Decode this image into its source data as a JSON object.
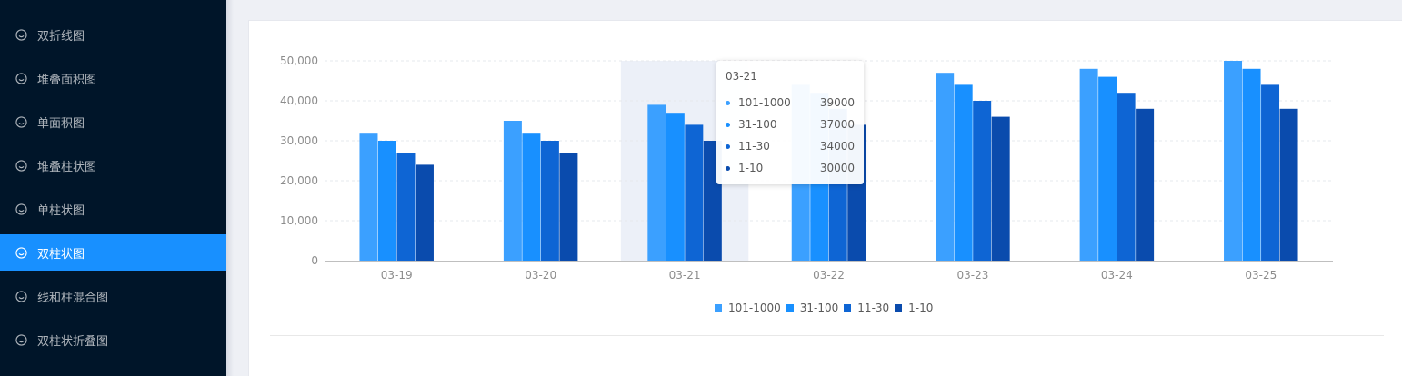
{
  "sidebar": {
    "items": [
      {
        "label": "双折线图",
        "active": false
      },
      {
        "label": "堆叠面积图",
        "active": false
      },
      {
        "label": "单面积图",
        "active": false
      },
      {
        "label": "堆叠柱状图",
        "active": false
      },
      {
        "label": "单柱状图",
        "active": false
      },
      {
        "label": "双柱状图",
        "active": true
      },
      {
        "label": "线和柱混合图",
        "active": false
      },
      {
        "label": "双柱状折叠图",
        "active": false
      }
    ]
  },
  "colors": {
    "sidebar_bg": "#001529",
    "active_bg": "#1890ff",
    "series": [
      "#3ba0ff",
      "#1890ff",
      "#0e65d4",
      "#0a4bad"
    ]
  },
  "chart_data": {
    "type": "bar",
    "categories": [
      "03-19",
      "03-20",
      "03-21",
      "03-22",
      "03-23",
      "03-24",
      "03-25"
    ],
    "series": [
      {
        "name": "101-1000",
        "values": [
          32000,
          35000,
          39000,
          44000,
          47000,
          48000,
          50000
        ]
      },
      {
        "name": "31-100",
        "values": [
          30000,
          32000,
          37000,
          42000,
          44000,
          46000,
          48000
        ]
      },
      {
        "name": "11-30",
        "values": [
          27000,
          30000,
          34000,
          38000,
          40000,
          42000,
          44000
        ]
      },
      {
        "name": "1-10",
        "values": [
          24000,
          27000,
          30000,
          34000,
          36000,
          38000,
          38000
        ]
      }
    ],
    "yticks": [
      "0",
      "10,000",
      "20,000",
      "30,000",
      "40,000",
      "50,000"
    ],
    "ylim": [
      0,
      50000
    ],
    "grid": true,
    "legend": "bottom",
    "highlighted_category": "03-21"
  },
  "tooltip": {
    "title": "03-21",
    "rows": [
      {
        "name": "101-1000",
        "value": "39000"
      },
      {
        "name": "31-100",
        "value": "37000"
      },
      {
        "name": "11-30",
        "value": "34000"
      },
      {
        "name": "1-10",
        "value": "30000"
      }
    ]
  }
}
